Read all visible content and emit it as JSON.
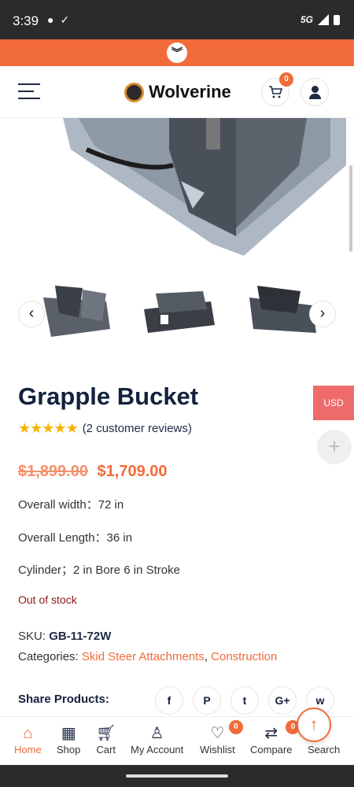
{
  "status_bar": {
    "time": "3:39",
    "network": "5G"
  },
  "header": {
    "brand": "Wolverine",
    "cart_count": "0"
  },
  "product": {
    "title": "Grapple Bucket",
    "stars": "★★★★★",
    "reviews": "(2 customer reviews)",
    "old_price": "$1,899.00",
    "new_price": "$1,709.00",
    "specs": [
      "Overall width：72 in",
      "Overall Length：36 in",
      "Cylinder；2 in Bore 6 in Stroke"
    ],
    "stock": "Out of stock",
    "sku_label": "SKU:",
    "sku": "GB-11-72W",
    "categories_label": "Categories:",
    "categories": [
      "Skid Steer Attachments",
      "Construction"
    ]
  },
  "currency": "USD",
  "share": {
    "label": "Share Products:",
    "icons": [
      "f",
      "P",
      "t",
      "G+",
      "w"
    ]
  },
  "bottom_nav": [
    {
      "label": "Home",
      "icon": "home-icon"
    },
    {
      "label": "Shop",
      "icon": "grid-icon"
    },
    {
      "label": "Cart",
      "icon": "cart-icon"
    },
    {
      "label": "My Account",
      "icon": "user-icon"
    },
    {
      "label": "Wishlist",
      "icon": "heart-icon",
      "badge": "0"
    },
    {
      "label": "Compare",
      "icon": "compare-icon",
      "badge": "0"
    },
    {
      "label": "Search",
      "icon": "search-icon"
    }
  ],
  "colors": {
    "accent": "#f26b3a",
    "navy": "#14213d",
    "usd": "#ef6b6b"
  }
}
